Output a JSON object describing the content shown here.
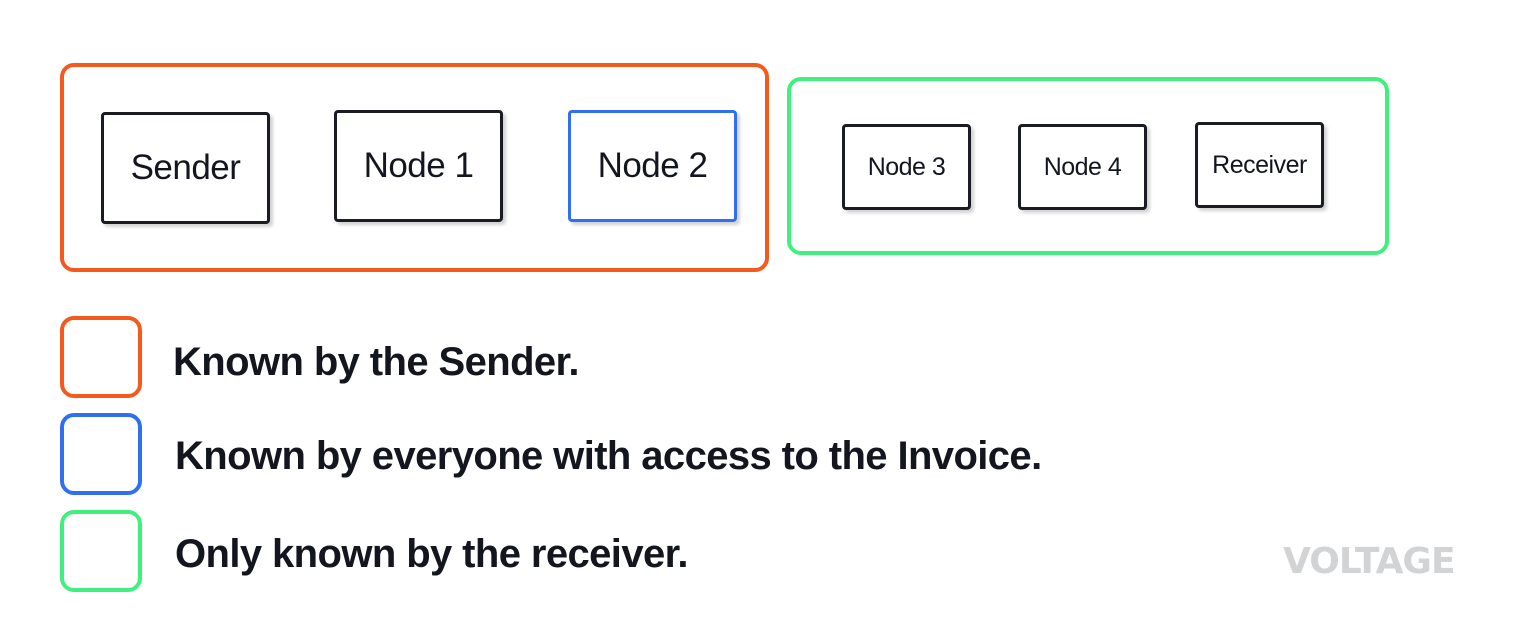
{
  "groups": {
    "known_by_sender": {
      "border_color": "#f45a1e",
      "nodes": [
        "Sender",
        "Node 1",
        "Node 2"
      ]
    },
    "known_by_receiver": {
      "border_color": "#3ff07f",
      "nodes": [
        "Node 3",
        "Node 4",
        "Receiver"
      ]
    }
  },
  "node_highlight_color": "#2f6ff0",
  "legend": [
    {
      "color": "#f45a1e",
      "label": "Known by the Sender."
    },
    {
      "color": "#2f6ff0",
      "label": "Known by everyone with access to the Invoice."
    },
    {
      "color": "#3ff07f",
      "label": "Only known by the receiver."
    }
  ],
  "logo": {
    "text": "VOLTAGE",
    "color": "#d2d3d5"
  }
}
